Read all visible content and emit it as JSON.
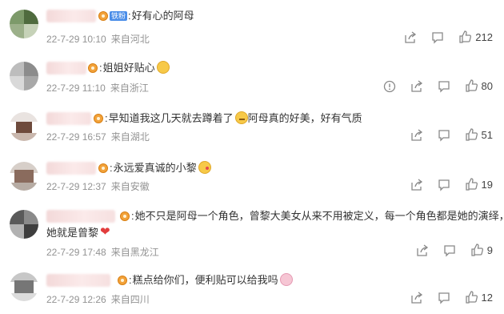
{
  "comments": [
    {
      "text": "好有心的阿母",
      "date": "22-7-29 10:10",
      "location": "来自河北",
      "likes": "212",
      "has_report": false
    },
    {
      "text": "姐姐好贴心",
      "date": "22-7-29 11:10",
      "location": "来自浙江",
      "likes": "80",
      "has_report": true
    },
    {
      "text": "早知道我这几天就去蹲着了",
      "text2": "阿母真的好美，好有气质",
      "date": "22-7-29 16:57",
      "location": "来自湖北",
      "likes": "51",
      "has_report": false
    },
    {
      "text": "永远爱真诚的小黎",
      "date": "22-7-29 12:37",
      "location": "来自安徽",
      "likes": "19",
      "has_report": false
    },
    {
      "text": "她不只是阿母一个角色，曾黎大美女从来不用被定义，每一个角色都是她的演绎，",
      "text_line2": "她就是曾黎",
      "date": "22-7-29 17:48",
      "location": "来自黑龙江",
      "likes": "9",
      "has_report": false
    },
    {
      "text": "糕点给你们，便利贴可以给我吗",
      "date": "22-7-29 12:26",
      "location": "来自四川",
      "likes": "12",
      "has_report": false
    }
  ],
  "badge_tag": "铁粉",
  "icons": {
    "share": "share-icon",
    "comment": "comment-icon",
    "like": "thumbs-up-icon",
    "report": "report-icon"
  }
}
